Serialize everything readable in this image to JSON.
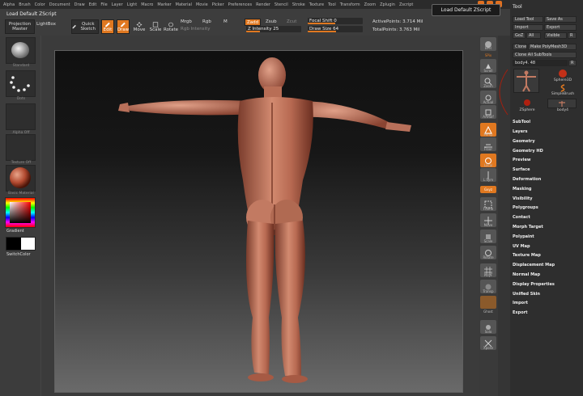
{
  "menu": [
    "Alpha",
    "Brush",
    "Color",
    "Document",
    "Draw",
    "Edit",
    "File",
    "Layer",
    "Light",
    "Macro",
    "Marker",
    "Material",
    "Movie",
    "Picker",
    "Preferences",
    "Render",
    "Stencil",
    "Stroke",
    "Texture",
    "Tool",
    "Transform",
    "Zoom",
    "Zplugin",
    "Zscript"
  ],
  "toolbar": {
    "title": "Load Default ZScript",
    "projection_master": "Projection Master",
    "lightbox": "LightBox",
    "quick_sketch": "Quick Sketch",
    "edit": "Edit",
    "draw": "Draw",
    "move": "Move",
    "scale": "Scale",
    "rotate": "Rotate",
    "mrgb": "Mrgb",
    "rgb": "Rgb",
    "m": "M",
    "rgb_intensity": "Rgb Intensity",
    "zadd": "Zadd",
    "zsub": "Zsub",
    "zcut": "Zcut",
    "z_intensity": "Z Intensity 25",
    "focal_shift": "Focal Shift 0",
    "draw_size": "Draw Size 64",
    "active_points": "ActivePoints: 3.714 Mil",
    "total_points": "TotalPoints: 3.763 Mil"
  },
  "tooltip": "Load Default ZScript",
  "left": {
    "standard": "Standard",
    "dots": "Dots",
    "alpha_off": "Alpha Off",
    "texture_off": "Texture Off",
    "material": "Basic Material",
    "gradient": "Gradient",
    "switch_color": "SwitchColor"
  },
  "right": [
    "BPR",
    "SPix",
    "Scroll",
    "Zoom",
    "Actual",
    "AAHalf",
    "Persp",
    "Floor",
    "Local",
    "L.Sym",
    "Gxyz",
    "Frame",
    "Move",
    "Scale",
    "Rotate",
    "PolyF",
    "Transp",
    "Ghost",
    "Solo",
    "Xpose"
  ],
  "tool": {
    "title": "Tool",
    "load_tool": "Load Tool",
    "save_as": "Save As",
    "import": "Import",
    "export": "Export",
    "goz": "GoZ",
    "all": "All",
    "visible": "Visible",
    "r": "R",
    "clone": "Clone",
    "make_polymesh": "Make PolyMesh3D",
    "clone_all": "Clone All SubTools",
    "current": "body4. 48",
    "r2": "R",
    "thumbs": [
      "",
      "Sphere3D",
      "SimpleBrush",
      "ZSphere",
      "body4"
    ],
    "sections": [
      "SubTool",
      "Layers",
      "Geometry",
      "Geometry HD",
      "Preview",
      "Surface",
      "Deformation",
      "Masking",
      "Visibility",
      "Polygroups",
      "Contact",
      "Morph Target",
      "Polypaint",
      "UV Map",
      "Texture Map",
      "Displacement Map",
      "Normal Map",
      "Display Properties",
      "Unified Skin",
      "Import",
      "Export"
    ]
  },
  "colors": {
    "accent": "#e07820",
    "skin": "#c27a62",
    "panel": "#2e2e2e"
  }
}
